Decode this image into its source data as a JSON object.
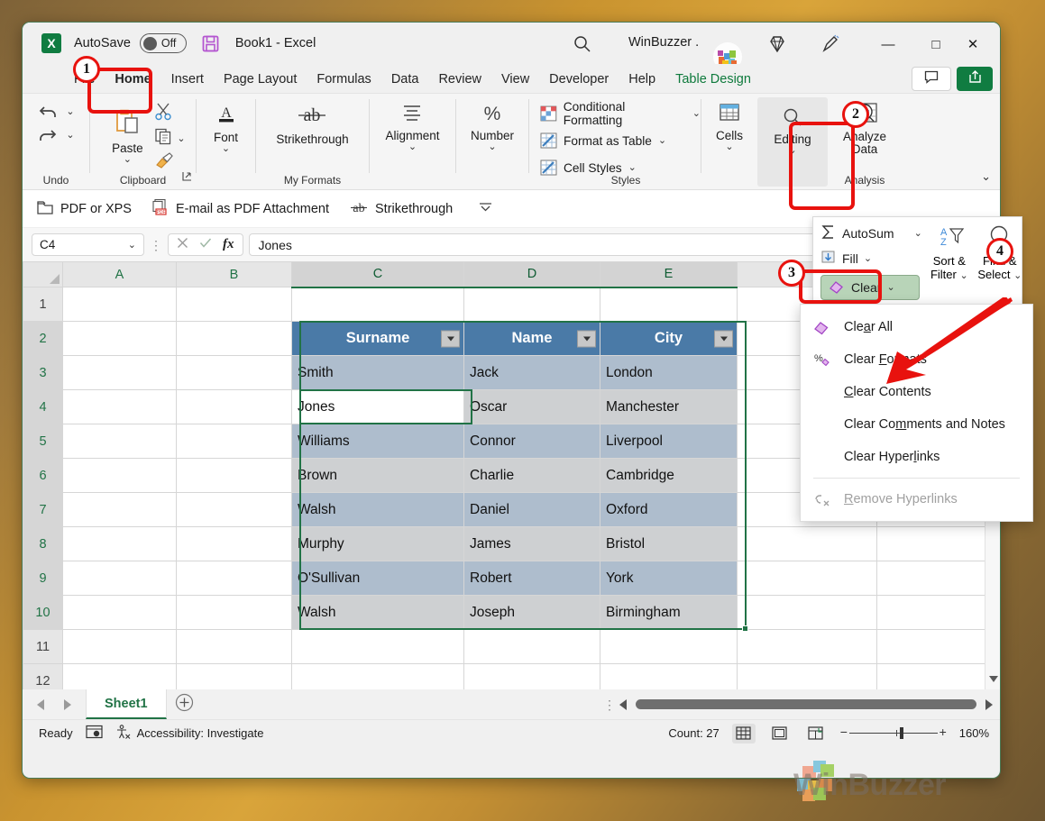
{
  "titlebar": {
    "app_logo": "excel-logo",
    "autosave_label": "AutoSave",
    "autosave_state": "Off",
    "save_icon": "save-icon",
    "document_title": "Book1  -  Excel",
    "search_icon": "search-icon",
    "account_name": "WinBuzzer .",
    "diamond_icon": "diamond-icon",
    "pen_icon": "pen-icon",
    "minimize": "—",
    "maximize": "□",
    "close": "✕"
  },
  "tabs": [
    {
      "label": "File"
    },
    {
      "label": "Home"
    },
    {
      "label": "Insert"
    },
    {
      "label": "Page Layout"
    },
    {
      "label": "Formulas"
    },
    {
      "label": "Data"
    },
    {
      "label": "Review"
    },
    {
      "label": "View"
    },
    {
      "label": "Developer"
    },
    {
      "label": "Help"
    },
    {
      "label": "Table Design"
    }
  ],
  "tab_right": {
    "comments_icon": "comment-icon",
    "share_icon": "share-icon"
  },
  "ribbon": {
    "undo": {
      "label": "Undo",
      "undo_icon": "undo-icon",
      "redo_icon": "redo-icon"
    },
    "clipboard": {
      "label": "Clipboard",
      "paste_label": "Paste",
      "cut_icon": "scissors-icon",
      "copy_icon": "copy-icon",
      "format_painter_icon": "format-painter-icon",
      "dialog_launcher": "dialog-launcher-icon"
    },
    "font": {
      "label": "",
      "button_label": "Font"
    },
    "myformats": {
      "label": "My Formats",
      "button_label": "Strikethrough"
    },
    "alignment": {
      "button_label": "Alignment"
    },
    "number": {
      "button_label": "Number"
    },
    "styles": {
      "label": "Styles",
      "items": [
        {
          "label": "Conditional Formatting"
        },
        {
          "label": "Format as Table"
        },
        {
          "label": "Cell Styles"
        }
      ]
    },
    "cells": {
      "button_label": "Cells"
    },
    "editing": {
      "button_label": "Editing"
    },
    "analysis": {
      "label": "Analysis",
      "button_label_line1": "Analyze",
      "button_label_line2": "Data"
    },
    "collapse_icon": "chevron-up-icon"
  },
  "custom_toolbar": [
    {
      "label": "PDF or XPS",
      "icon": "pdf-export-icon"
    },
    {
      "label": "E-mail as PDF Attachment",
      "icon": "email-pdf-icon"
    },
    {
      "label": "Strikethrough",
      "icon": "strikethrough-icon"
    },
    {
      "label": "",
      "icon": "overflow-chevron-icon"
    }
  ],
  "formula_bar": {
    "name_box_value": "C4",
    "cancel_icon": "cancel-icon",
    "enter_icon": "checkmark-icon",
    "fx_label": "fx",
    "formula_value": "Jones"
  },
  "grid": {
    "columns": [
      "A",
      "B",
      "C",
      "D",
      "E"
    ],
    "selected_columns": [
      "C",
      "D",
      "E"
    ],
    "rows": [
      "1",
      "2",
      "3",
      "4",
      "5",
      "6",
      "7",
      "8",
      "9",
      "10",
      "11",
      "12"
    ],
    "selected_rows": [
      "2",
      "3",
      "4",
      "5",
      "6",
      "7",
      "8",
      "9",
      "10"
    ],
    "table_headers": [
      "Surname",
      "Name",
      "City"
    ],
    "table_rows": [
      [
        "Smith",
        "Jack",
        "London"
      ],
      [
        "Jones",
        "Oscar",
        "Manchester"
      ],
      [
        "Williams",
        "Connor",
        "Liverpool"
      ],
      [
        "Brown",
        "Charlie",
        "Cambridge"
      ],
      [
        "Walsh",
        "Daniel",
        "Oxford"
      ],
      [
        "Murphy",
        "James",
        "Bristol"
      ],
      [
        "O'Sullivan",
        "Robert",
        "York"
      ],
      [
        "Walsh",
        "Joseph",
        "Birmingham"
      ]
    ],
    "active_cell": "C4",
    "filter_icon": "filter-dropdown-icon"
  },
  "editing_flyout": [
    {
      "label": "AutoSum",
      "icon": "sigma-icon",
      "has_chevron": true
    },
    {
      "label": "Fill",
      "icon": "fill-down-icon",
      "has_chevron": true
    },
    {
      "label": "Clear",
      "icon": "eraser-icon",
      "has_chevron": true
    },
    {
      "label": "Sort & Filter",
      "icon": "sort-filter-icon",
      "has_chevron": true
    },
    {
      "label": "Find & Select",
      "icon": "magnifier-icon",
      "has_chevron": true
    }
  ],
  "clear_menu": [
    {
      "label": "Clear All",
      "icon": "eraser-icon",
      "accel": "a",
      "disabled": false
    },
    {
      "label": "Clear Formats",
      "icon": "percent-eraser-icon",
      "accel": "F",
      "disabled": false
    },
    {
      "label": "Clear Contents",
      "icon": "",
      "accel": "C",
      "disabled": false
    },
    {
      "label": "Clear Comments and Notes",
      "icon": "",
      "accel": "m",
      "disabled": false
    },
    {
      "label": "Clear Hyperlinks",
      "icon": "",
      "accel": "l",
      "disabled": false
    },
    {
      "label": "Remove Hyperlinks",
      "icon": "remove-hyperlink-icon",
      "accel": "R",
      "disabled": true
    }
  ],
  "sheet_bar": {
    "prev_icon": "nav-left-icon",
    "next_icon": "nav-right-icon",
    "sheet_name": "Sheet1",
    "add_sheet_icon": "plus-circle-icon"
  },
  "status_bar": {
    "state": "Ready",
    "macro_icon": "record-macro-icon",
    "accessibility_icon": "accessibility-icon",
    "accessibility_label": "Accessibility: Investigate",
    "count_label": "Count: 27",
    "view_normal_icon": "normal-view-icon",
    "view_pagelayout_icon": "page-layout-view-icon",
    "view_pagebreak_icon": "page-break-view-icon",
    "zoom_level": "160%"
  },
  "annotations": {
    "badges": [
      "1",
      "2",
      "3",
      "4"
    ],
    "accent_color": "#e8120e"
  },
  "watermark": {
    "text": "WinBuzzer"
  }
}
